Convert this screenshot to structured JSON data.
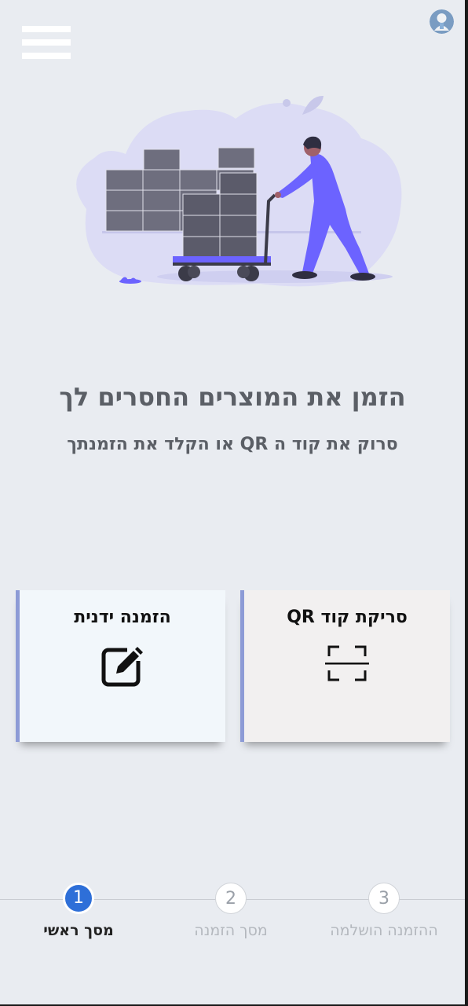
{
  "header": {
    "menu_icon": "hamburger-icon",
    "avatar_icon": "user-avatar"
  },
  "main": {
    "title": "הזמן את המוצרים החסרים לך",
    "subtitle": "סרוק את קוד ה QR או הקלד את הזמנתך"
  },
  "cards": {
    "manual": {
      "label": "הזמנה ידנית",
      "icon": "edit-icon"
    },
    "qr": {
      "label": "סריקת קוד QR",
      "icon": "scan-icon"
    }
  },
  "stepper": {
    "steps": [
      {
        "number": "1",
        "label": "מסך ראשי",
        "active": true
      },
      {
        "number": "2",
        "label": "מסך הזמנה",
        "active": false
      },
      {
        "number": "3",
        "label": "ההזמנה הושלמה",
        "active": false
      }
    ]
  },
  "colors": {
    "background": "#e9ecf1",
    "accent": "#2e6fd8",
    "card_border": "#8d9bd6",
    "illustration_primary": "#6c63ff"
  }
}
